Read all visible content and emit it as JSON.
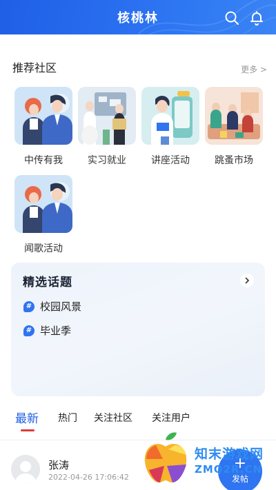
{
  "header": {
    "title": "核桃林",
    "search_icon": "search-icon",
    "bell_icon": "bell-icon",
    "color": "#2a6ff0"
  },
  "recommended": {
    "title": "推荐社区",
    "more_label": "更多 >",
    "communities": [
      {
        "label": "中传有我"
      },
      {
        "label": "实习就业"
      },
      {
        "label": "讲座活动"
      },
      {
        "label": "跳蚤市场"
      },
      {
        "label": "闻歌活动"
      }
    ]
  },
  "topics": {
    "title": "精选话题",
    "items": [
      {
        "label": "校园风景"
      },
      {
        "label": "毕业季"
      }
    ]
  },
  "tabs": [
    {
      "label": "最新",
      "active": true
    },
    {
      "label": "热门"
    },
    {
      "label": "关注社区"
    },
    {
      "label": "关注用户"
    }
  ],
  "post": {
    "username": "张涛",
    "time": "2022-04-26 17:06:42"
  },
  "fab": {
    "plus": "+",
    "label": "发帖"
  },
  "watermark": {
    "line1": "知末游戏网",
    "line2": "ZMQ2R.CN"
  },
  "colors": {
    "accent": "#2f74f0",
    "tab_indicator": "#e03a3a"
  }
}
